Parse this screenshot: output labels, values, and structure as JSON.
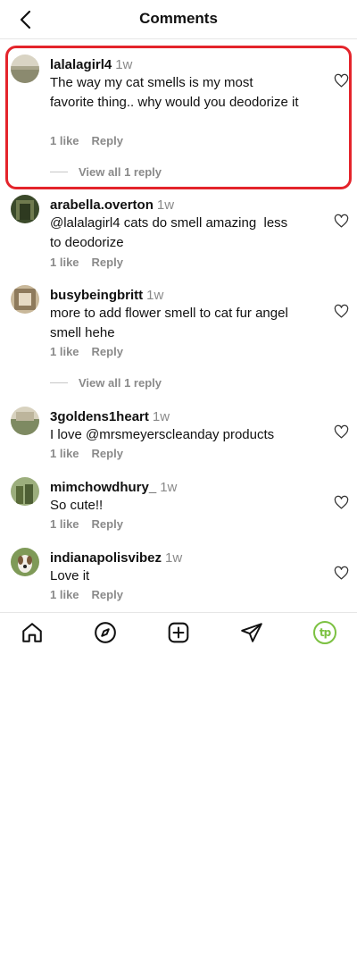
{
  "header": {
    "title": "Comments"
  },
  "comments": [
    {
      "username": "lalalagirl4",
      "time": "1w",
      "text": "The way my cat smells is my most favorite thing.. why would you deodorize it ⁣",
      "likes": "1 like",
      "reply": "Reply",
      "view_replies": "View all 1 reply"
    },
    {
      "username": "arabella.overton",
      "time": "1w",
      "text": "@lalalagirl4 cats do smell amazing ⁣ less to deodorize",
      "likes": "1 like",
      "reply": "Reply"
    },
    {
      "username": "busybeingbritt",
      "time": "1w",
      "text": "more to add flower smell to cat fur angel smell hehe",
      "likes": "1 like",
      "reply": "Reply",
      "view_replies": "View all 1 reply"
    },
    {
      "username": "3goldens1heart",
      "time": "1w",
      "text": "I love @mrsmeyerscleanday products ⁣",
      "likes": "1 like",
      "reply": "Reply"
    },
    {
      "username": "mimchowdhury_",
      "time": "1w",
      "text": "So cute!!⁣",
      "likes": "1 like",
      "reply": "Reply"
    },
    {
      "username": "indianapolisvibez",
      "time": "1w",
      "text": "Love it",
      "likes": "1 like",
      "reply": "Reply"
    }
  ],
  "tabbar": {
    "items": [
      "home-icon",
      "explore-icon",
      "create-icon",
      "direct-message-icon",
      "profile-icon"
    ],
    "profile_initials": "tp",
    "profile_color": "#7cc142"
  },
  "colors": {
    "highlight": "#e4242b",
    "muted": "#8a8a8a"
  }
}
